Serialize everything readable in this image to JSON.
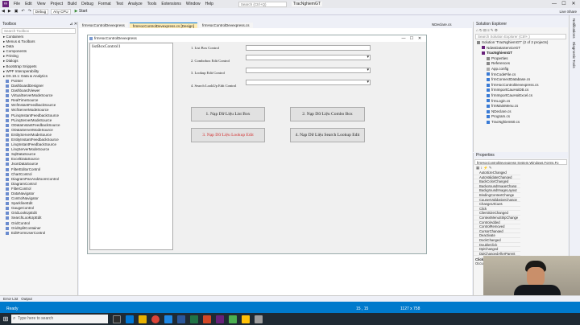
{
  "app": {
    "title_menu": [
      "File",
      "Edit",
      "View",
      "Project",
      "Build",
      "Debug",
      "Format",
      "Test",
      "Analyze",
      "Tools",
      "Extensions",
      "Window",
      "Help"
    ],
    "search_placeholder": "Search (Ctrl+Q)",
    "solution_name": "TracNghiemGT",
    "win_min": "—",
    "win_max": "☐",
    "win_close": "✕"
  },
  "toolbar": {
    "config": "Debug",
    "platform": "Any CPU",
    "start_label": "Start",
    "start_icon": "▶",
    "live_share": "Live Share"
  },
  "toolbox": {
    "title": "Toolbox",
    "search": "Search Toolbox",
    "items": [
      {
        "label": "Containers",
        "cat": true
      },
      {
        "label": "Menus & Toolbars",
        "cat": true
      },
      {
        "label": "Data",
        "cat": true
      },
      {
        "label": "Components",
        "cat": true
      },
      {
        "label": "Printing",
        "cat": true
      },
      {
        "label": "Dialogs",
        "cat": true
      },
      {
        "label": "Bootstrap Snippets",
        "cat": true
      },
      {
        "label": "WPF Interoperability",
        "cat": true
      },
      {
        "label": "DX.19.1: Data & Analytics",
        "cat": true
      },
      {
        "label": "Pointer"
      },
      {
        "label": "DashboardDesigner"
      },
      {
        "label": "DashboardViewer"
      },
      {
        "label": "VirtualServerModeSource"
      },
      {
        "label": "RealTimeSource"
      },
      {
        "label": "WcfInstantFeedbackSource"
      },
      {
        "label": "WcfServerModeSource"
      },
      {
        "label": "PLinqInstantFeedbackSource"
      },
      {
        "label": "PLinqServerModeSource"
      },
      {
        "label": "ODataInstantFeedbackSource"
      },
      {
        "label": "ODataServerModeSource"
      },
      {
        "label": "EntityServerModeSource"
      },
      {
        "label": "EntityInstantFeedbackSource"
      },
      {
        "label": "LinqInstantFeedbackSource"
      },
      {
        "label": "LinqServerModeSource"
      },
      {
        "label": "SqlDataSource"
      },
      {
        "label": "ExcelDataSource"
      },
      {
        "label": "JsonDataSource"
      },
      {
        "label": "FilterEditorControl"
      },
      {
        "label": "ChartControl"
      },
      {
        "label": "DiagramPanAndZoomControl"
      },
      {
        "label": "DiagramControl"
      },
      {
        "label": "FilterControl"
      },
      {
        "label": "DataNavigator"
      },
      {
        "label": "ControlNavigator"
      },
      {
        "label": "SparklineEdit"
      },
      {
        "label": "GaugeControl"
      },
      {
        "label": "GridLookUpEdit"
      },
      {
        "label": "SearchLookUpEdit"
      },
      {
        "label": "GridControl"
      },
      {
        "label": "GridSplitContainer"
      },
      {
        "label": "EditFormUserControl"
      }
    ]
  },
  "tabs": [
    {
      "label": "frmHocControlDevexpress"
    },
    {
      "label": "frmHocControlDevexpress.cs [Design]",
      "active": true
    },
    {
      "label": "frmHocControlDevexpress.cs"
    },
    {
      "label": "NDeclare.cs"
    }
  ],
  "form": {
    "title": "frmHocControlDevexpress",
    "listbox_item": "listBoxControl1",
    "labels": [
      "1. List Box Control",
      "2. Combobox Edit Control",
      "3. Lookup Edit Control",
      "4. Search LookUp Edit Control"
    ],
    "buttons": [
      "1. Nạp Dữ Liệu List Box",
      "2. Nạp Dữ Liệu Combo Box",
      "3. Nạp Dữ Liệu Lookup Edit",
      "4. Nạp Dữ Liệu Search Lookup Edit"
    ]
  },
  "solution_explorer": {
    "title": "Solution Explorer",
    "search": "Search Solution Explorer (Ctrl+;)",
    "items": [
      {
        "label": "Solution 'TracNghiemGT' (2 of 2 projects)",
        "lvl": 0,
        "c": "#888"
      },
      {
        "label": "NdwsDataServiceGT",
        "lvl": 1,
        "c": "#68217a"
      },
      {
        "label": "TracNghiemGT",
        "lvl": 1,
        "c": "#68217a",
        "bold": true
      },
      {
        "label": "Properties",
        "lvl": 2,
        "c": "#888"
      },
      {
        "label": "References",
        "lvl": 2,
        "c": "#888"
      },
      {
        "label": "App.config",
        "lvl": 2,
        "c": "#aaa"
      },
      {
        "label": "frmCodeFile.cs",
        "lvl": 2,
        "c": "#3a7bd5"
      },
      {
        "label": "frmConnectDatabase.cs",
        "lvl": 2,
        "c": "#3a7bd5"
      },
      {
        "label": "frmHocControlDevexpress.cs",
        "lvl": 2,
        "c": "#3a7bd5"
      },
      {
        "label": "frmImportCauHoiDB.cs",
        "lvl": 2,
        "c": "#3a7bd5"
      },
      {
        "label": "frmImportCauHoiExcel.cs",
        "lvl": 2,
        "c": "#3a7bd5"
      },
      {
        "label": "frmLogin.cs",
        "lvl": 2,
        "c": "#3a7bd5"
      },
      {
        "label": "frmMainMenu.cs",
        "lvl": 2,
        "c": "#3a7bd5"
      },
      {
        "label": "NDeclare.cs",
        "lvl": 2,
        "c": "#3a7bd5"
      },
      {
        "label": "Program.cs",
        "lvl": 2,
        "c": "#3a7bd5"
      },
      {
        "label": "TracNghiem60.cs",
        "lvl": 2,
        "c": "#3a7bd5"
      }
    ]
  },
  "properties": {
    "title": "Properties",
    "object": "frmHocControlDevexpress  System.Windows.Forms.Fo",
    "items": [
      "AutoSizeChanged",
      "AutoValidateChanged",
      "BackColorChanged",
      "BackgroundImageChang",
      "BackgroundImageLayout",
      "BindingContextChange",
      "CausesValidationChange",
      "ChangeUICues",
      "Click",
      "ClientSizeChanged",
      "ContextMenuStripChange",
      "ControlAdded",
      "ControlRemoved",
      "CursorChanged",
      "Deactivate",
      "DockChanged",
      "DoubleClick",
      "DpiChanged",
      "DpiChangedAfterParent"
    ],
    "desc_title": "Click",
    "desc": "Occurs when the component is clicked."
  },
  "right_strip": [
    "Notifications",
    "Diagnostic Tools"
  ],
  "bottom_tabs": [
    "Error List",
    "Output"
  ],
  "status": {
    "ready": "Ready",
    "pos": "15 , 15",
    "size": "1127 x 758"
  },
  "taskbar": {
    "search": "Type here to search"
  },
  "colors": {
    "accent": "#007acc",
    "button_red_text": "#d32f2f"
  }
}
